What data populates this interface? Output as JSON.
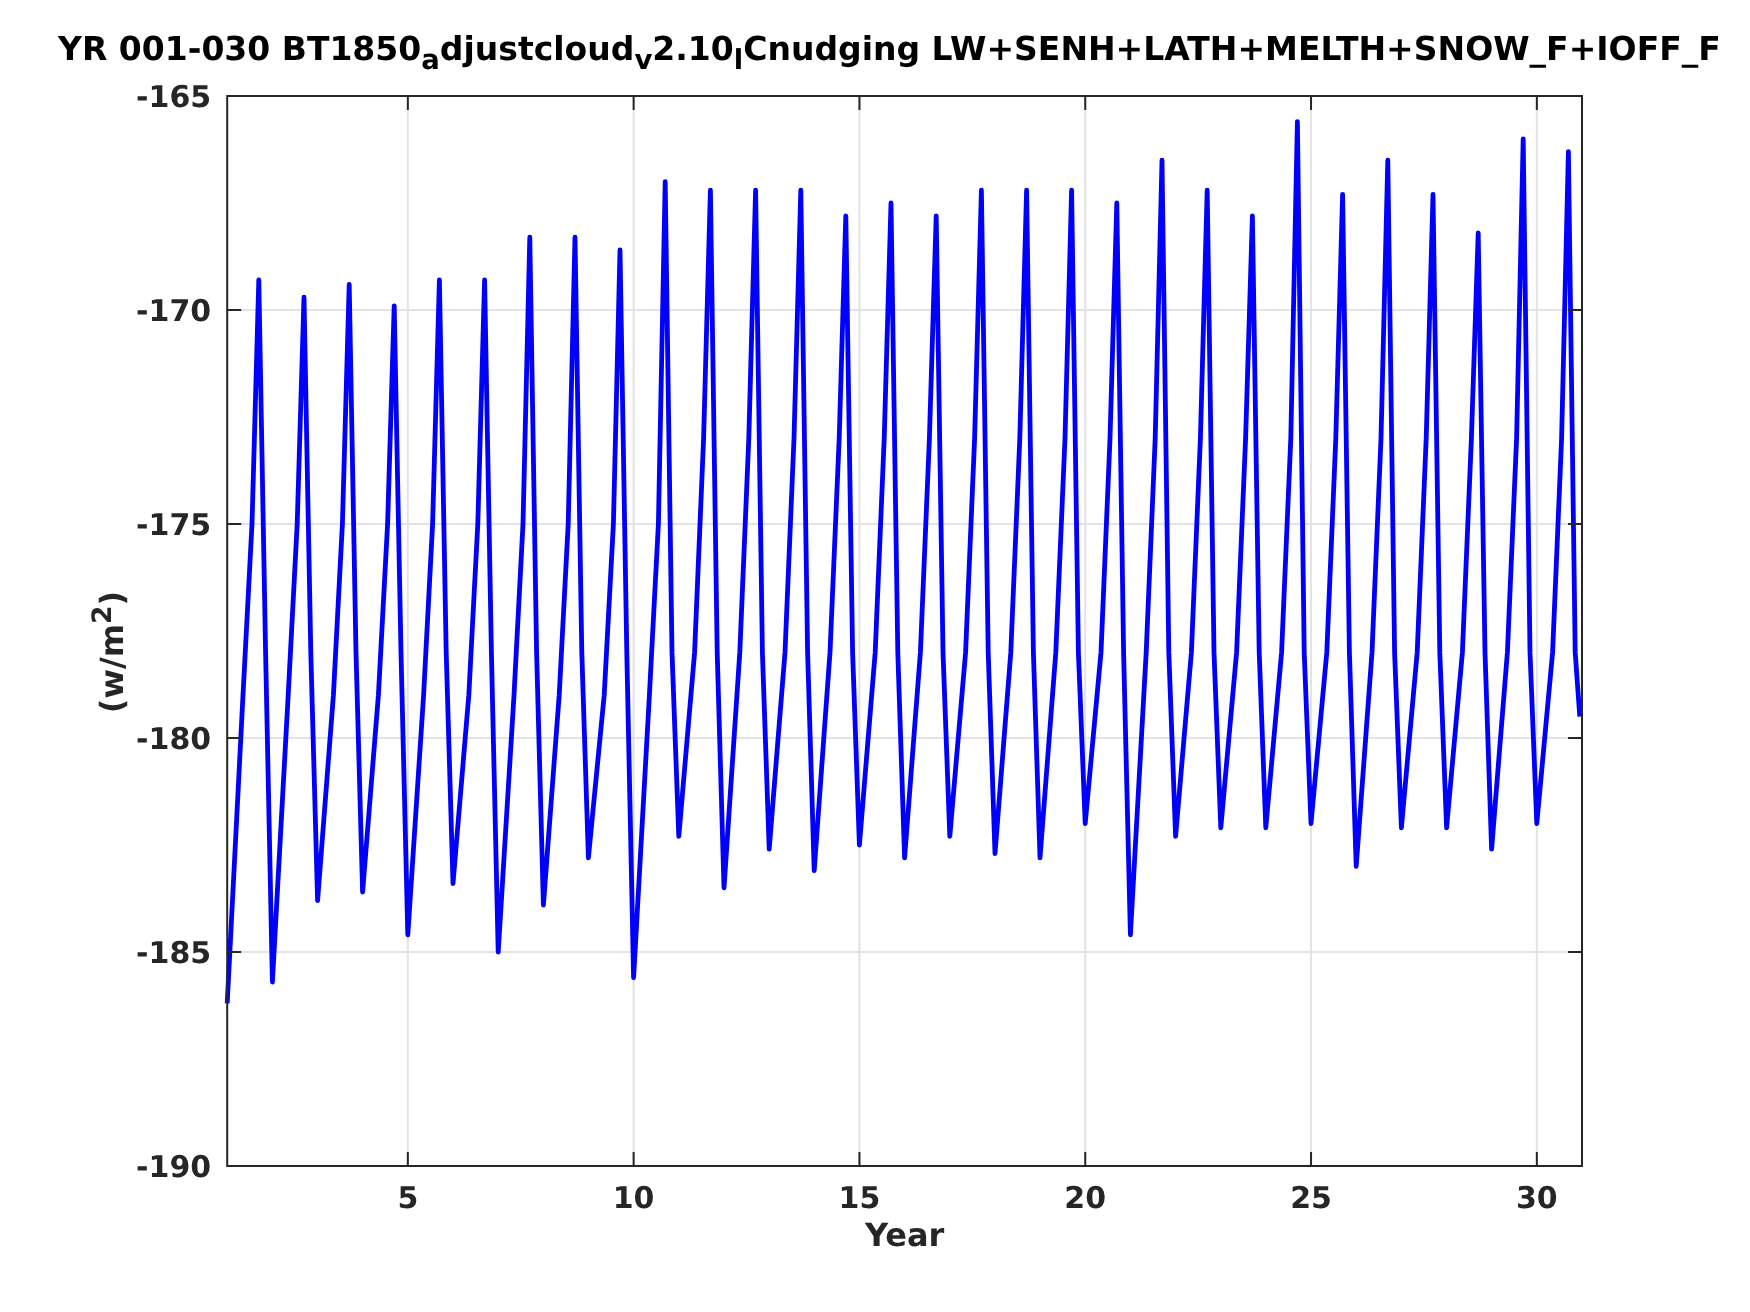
{
  "figure": {
    "title": "YR 001-030 BT1850$_{a}$djustcloud$_{v}$2.10$_{l}$Cnudging LW+SENH+LATH+MELTH+SNOW_F+IOFF_F",
    "chart_data": {
      "type": "line",
      "xlabel": "Year",
      "ylabel": "(w/m$^{2}$)",
      "xlim": [
        1,
        31
      ],
      "ylim": [
        -190,
        -165
      ],
      "xticks": [
        5,
        10,
        15,
        20,
        25,
        30
      ],
      "yticks": [
        -190,
        -185,
        -180,
        -175,
        -170,
        -165
      ],
      "x": [
        1,
        1.35,
        1.55,
        1.7,
        1.85,
        2,
        2.35,
        2.55,
        2.7,
        2.85,
        3,
        3.35,
        3.55,
        3.7,
        3.85,
        4,
        4.35,
        4.55,
        4.7,
        4.85,
        5,
        5.35,
        5.55,
        5.7,
        5.85,
        6,
        6.35,
        6.55,
        6.7,
        6.85,
        7,
        7.35,
        7.55,
        7.7,
        7.85,
        8,
        8.35,
        8.55,
        8.7,
        8.85,
        9,
        9.35,
        9.55,
        9.7,
        9.85,
        10,
        10.35,
        10.55,
        10.7,
        10.85,
        11,
        11.35,
        11.55,
        11.7,
        11.85,
        12,
        12.35,
        12.55,
        12.7,
        12.85,
        13,
        13.35,
        13.55,
        13.7,
        13.85,
        14,
        14.35,
        14.55,
        14.7,
        14.85,
        15,
        15.35,
        15.55,
        15.7,
        15.85,
        16,
        16.35,
        16.55,
        16.7,
        16.85,
        17,
        17.35,
        17.55,
        17.7,
        17.85,
        18,
        18.35,
        18.55,
        18.7,
        18.85,
        19,
        19.35,
        19.55,
        19.7,
        19.85,
        20,
        20.35,
        20.55,
        20.7,
        20.85,
        21,
        21.35,
        21.55,
        21.7,
        21.85,
        22,
        22.35,
        22.55,
        22.7,
        22.85,
        23,
        23.35,
        23.55,
        23.7,
        23.85,
        24,
        24.35,
        24.55,
        24.7,
        24.85,
        25,
        25.35,
        25.55,
        25.7,
        25.85,
        26,
        26.35,
        26.55,
        26.7,
        26.85,
        27,
        27.35,
        27.55,
        27.7,
        27.85,
        28,
        28.35,
        28.55,
        28.7,
        28.85,
        29,
        29.35,
        29.55,
        29.7,
        29.85,
        30,
        30.35,
        30.55,
        30.7,
        30.85,
        30.95
      ],
      "grid": true,
      "series": [
        {
          "color": "#0000ff",
          "values": [
            -186.2,
            -179,
            -175,
            -169.3,
            -178,
            -185.7,
            -179,
            -175,
            -169.7,
            -178,
            -183.8,
            -179,
            -175,
            -169.4,
            -178,
            -183.6,
            -179,
            -175,
            -169.9,
            -178,
            -184.6,
            -179,
            -175,
            -169.3,
            -178,
            -183.4,
            -179,
            -175,
            -169.3,
            -178,
            -185,
            -179,
            -175,
            -168.3,
            -178,
            -183.9,
            -179,
            -175,
            -168.3,
            -178,
            -182.8,
            -179,
            -175,
            -168.6,
            -178,
            -185.6,
            -179,
            -175,
            -167,
            -178,
            -182.3,
            -178,
            -173,
            -167.2,
            -178,
            -183.5,
            -178,
            -173,
            -167.2,
            -178,
            -182.6,
            -178,
            -173,
            -167.2,
            -178,
            -183.1,
            -178,
            -173,
            -167.8,
            -178,
            -182.5,
            -178,
            -173,
            -167.5,
            -178,
            -182.8,
            -178,
            -173,
            -167.8,
            -178,
            -182.3,
            -178,
            -173,
            -167.2,
            -178,
            -182.7,
            -178,
            -173,
            -167.2,
            -178,
            -182.8,
            -178,
            -173,
            -167.2,
            -178,
            -182,
            -178,
            -173,
            -167.5,
            -178,
            -184.6,
            -178,
            -173,
            -166.5,
            -178,
            -182.3,
            -178,
            -173,
            -167.2,
            -178,
            -182.1,
            -178,
            -173,
            -167.8,
            -178,
            -182.1,
            -178,
            -173,
            -165.6,
            -178,
            -182,
            -178,
            -173,
            -167.3,
            -178,
            -183,
            -178,
            -173,
            -166.5,
            -178,
            -182.1,
            -178,
            -173,
            -167.3,
            -178,
            -182.1,
            -178,
            -173,
            -168.2,
            -178,
            -182.6,
            -178,
            -173,
            -166,
            -178,
            -182,
            -178,
            -173,
            -166.3,
            -178,
            -179.5
          ]
        }
      ]
    }
  }
}
